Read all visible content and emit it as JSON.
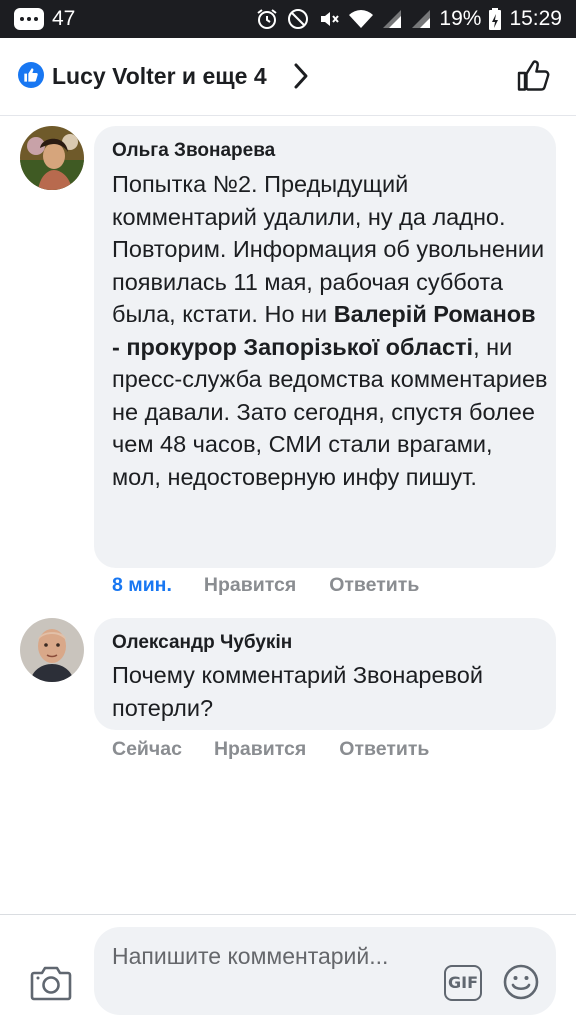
{
  "status_bar": {
    "notification_count": "47",
    "battery": "19%",
    "time": "15:29"
  },
  "header": {
    "title": "Lucy Volter и еще 4",
    "icons": [
      "like-badge-icon",
      "chevron-right-icon",
      "thumbs-up-icon"
    ]
  },
  "comments": [
    {
      "author": "Ольга Звонарева",
      "text_parts": {
        "p1": "Попытка №2. Предыдущий комментарий удалили, ну да ладно. Повторим. Информация об увольнении появилась 11 мая, рабочая суббота была, кстати. Но ни ",
        "mention": "Валерій Романов - прокурор Запорізької області",
        "p2": ", ни пресс-служба ведомства комментариев не давали. Зато сегодня, спустя более чем 48 часов, СМИ стали врагами, мол, недостоверную инфу пишут."
      },
      "time": "8 мин.",
      "like_label": "Нравится",
      "reply_label": "Ответить"
    },
    {
      "author": "Олександр Чубукін",
      "text": "Почему комментарий Звонаревой потерли?",
      "time": "Сейчас",
      "like_label": "Нравится",
      "reply_label": "Ответить"
    }
  ],
  "composer": {
    "placeholder": "Напишите комментарий...",
    "gif_label": "GIF",
    "icons": [
      "camera-icon",
      "gif-icon",
      "emoji-icon"
    ]
  },
  "colors": {
    "brand_blue": "#1877f2",
    "bubble_bg": "#f0f2f5",
    "status_bar_bg": "#1c1d21",
    "muted_text": "#8a8d91"
  }
}
